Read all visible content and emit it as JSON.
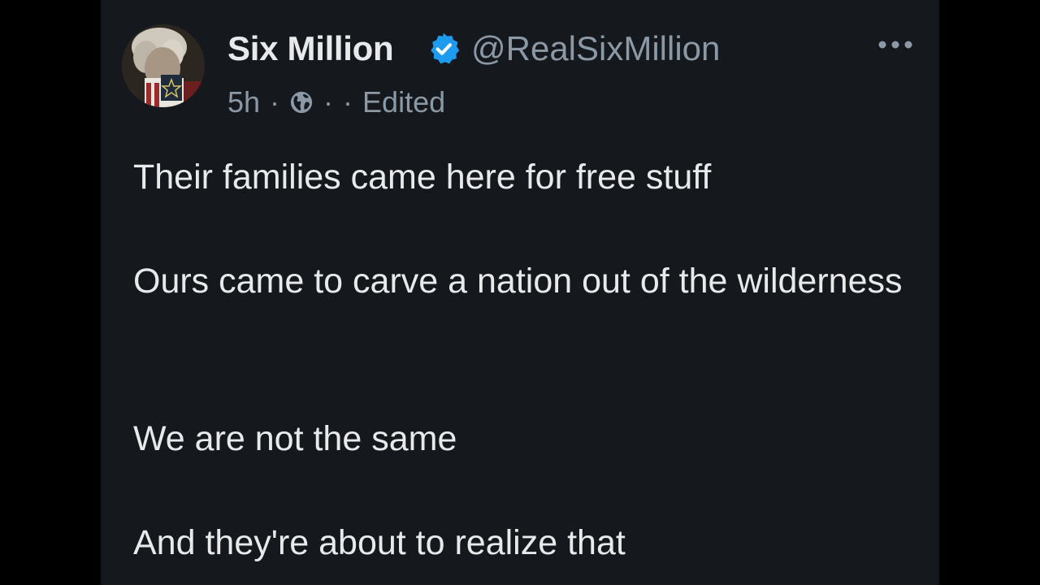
{
  "post": {
    "author": {
      "display_name": "Six Million",
      "handle": "@RealSixMillion",
      "verified": true,
      "avatar_icon": "avatar-photo"
    },
    "meta": {
      "time": "5h",
      "visibility_icon": "globe-icon",
      "status": "Edited"
    },
    "more_icon": "more-options-icon",
    "text_lines": [
      "Their families came here for free stuff",
      "Ours came to carve a nation out of the wilderness",
      "We are not the same",
      "And they're about to realize that"
    ]
  },
  "colors": {
    "background": "#000000",
    "card": "#15181c",
    "primary_text": "#e7e9ea",
    "secondary_text": "#8b98a5",
    "verified_blue": "#1d9bf0"
  }
}
